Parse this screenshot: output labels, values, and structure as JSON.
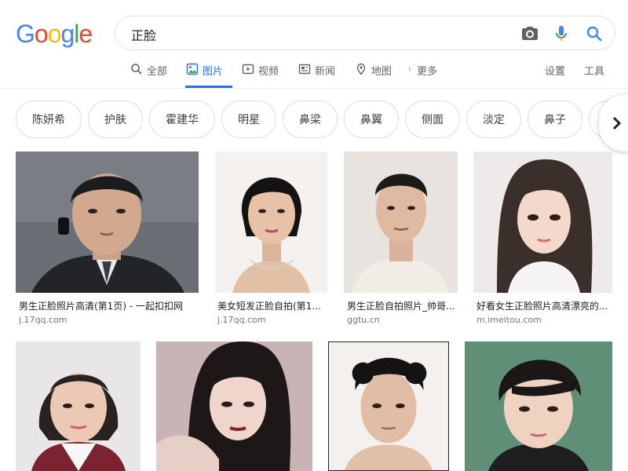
{
  "logo": {
    "letters": [
      "G",
      "o",
      "o",
      "g",
      "l",
      "e"
    ],
    "colors": [
      "#4285f4",
      "#ea4335",
      "#fbbc05",
      "#4285f4",
      "#34a853",
      "#ea4335"
    ]
  },
  "search": {
    "query": "正脸"
  },
  "tabs": {
    "all": "全部",
    "images": "图片",
    "video": "视频",
    "news": "新闻",
    "maps": "地图",
    "more": "更多",
    "settings": "设置",
    "tools": "工具"
  },
  "chips": [
    "陈妍希",
    "护肤",
    "霍建华",
    "明星",
    "鼻梁",
    "鼻翼",
    "侧面",
    "淡定",
    "鼻子"
  ],
  "results": [
    {
      "caption": "男生正脸照片高清(第1页) - 一起扣扣网",
      "source": "j.17qq.com"
    },
    {
      "caption": "美女短发正脸自拍(第1...",
      "source": "j.17qq.com"
    },
    {
      "caption": "男生正脸自拍照片_帅哥...",
      "source": "ggtu.cn"
    },
    {
      "caption": "好看女生正脸照片高清漂亮的...",
      "source": "m.imeitou.com"
    }
  ],
  "colors": {
    "accent": "#1a73e8",
    "chip_border": "#dadce0",
    "muted": "#5f6368"
  }
}
